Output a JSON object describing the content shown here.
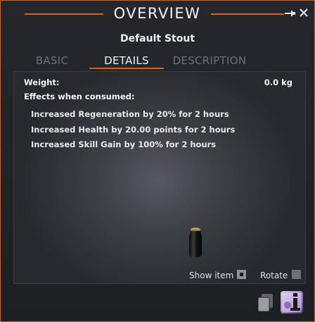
{
  "window": {
    "title": "OVERVIEW",
    "accent_color": "#c8652f",
    "icons": {
      "pin": "pin-icon",
      "close": "close-icon"
    }
  },
  "item": {
    "name": "Default Stout"
  },
  "tabs": [
    {
      "label": "BASIC",
      "active": false
    },
    {
      "label": "DETAILS",
      "active": true
    },
    {
      "label": "DESCRIPTION",
      "active": false
    }
  ],
  "details": {
    "weight_label": "Weight:",
    "weight_value": "0.0 kg",
    "effects_label": "Effects when consumed:",
    "effects": [
      "Increased Regeneration by 20% for 2 hours",
      "Increased Health by 20.00 points for 2 hours",
      "Increased Skill Gain by 100% for 2 hours"
    ]
  },
  "preview": {
    "show_item_label": "Show item",
    "show_item_checked": true,
    "rotate_label": "Rotate",
    "rotate_checked": false
  },
  "footer_icons": {
    "copy": "copy-icon",
    "info": "info-icon"
  }
}
